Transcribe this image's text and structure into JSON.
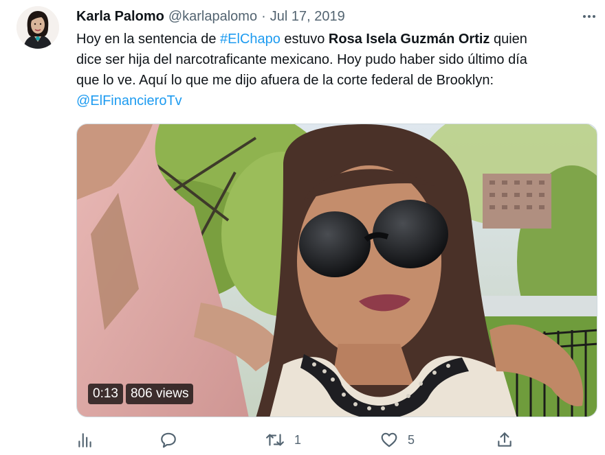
{
  "tweet": {
    "author_name": "Karla Palomo",
    "handle": "@karlapalomo",
    "separator": "·",
    "date": "Jul 17, 2019",
    "more_icon": "more-dots-icon",
    "text": {
      "l1_a": "Hoy en la sentencia de ",
      "l1_hashtag": "#ElChapo",
      "l1_b": " estuvo ",
      "l1_bold": "Rosa Isela Guzmán Ortiz",
      "l1_c": " quien",
      "l2": "dice ser hija del narcotraficante mexicano.  Hoy pudo haber sido último día",
      "l3": "que lo ve.   Aquí lo que me dijo afuera de la corte federal de Brooklyn:",
      "mention": "@ElFinancieroTv"
    },
    "media": {
      "duration": "0:13",
      "views": "806 views"
    },
    "actions": {
      "analytics_icon": "analytics-icon",
      "reply_icon": "reply-icon",
      "retweet_icon": "retweet-icon",
      "retweet_count": "1",
      "like_icon": "like-icon",
      "like_count": "5",
      "share_icon": "share-icon"
    },
    "colors": {
      "text": "#0f1419",
      "secondary": "#536471",
      "link": "#1d9bf0"
    }
  }
}
